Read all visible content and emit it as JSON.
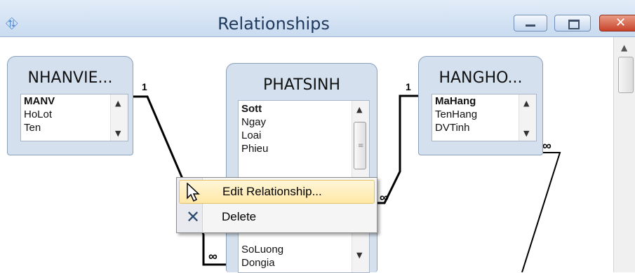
{
  "window": {
    "title": "Relationships",
    "app_icon": "relationships-icon",
    "controls": [
      "minimize-icon",
      "maximize-icon",
      "close-icon"
    ]
  },
  "tables": {
    "nhanvien": {
      "title": "NHANVIE...",
      "fields": [
        {
          "name": "MANV",
          "key": true
        },
        {
          "name": "HoLot",
          "key": false
        },
        {
          "name": "Ten",
          "key": false
        }
      ]
    },
    "phatsinh": {
      "title": "PHATSINH",
      "fields": [
        {
          "name": "Sott",
          "key": true
        },
        {
          "name": "Ngay",
          "key": false
        },
        {
          "name": "Loai",
          "key": false
        },
        {
          "name": "Phieu",
          "key": false
        },
        {
          "name": "SoLuong",
          "key": false
        },
        {
          "name": "Dongia",
          "key": false
        }
      ]
    },
    "hangho": {
      "title": "HANGHO...",
      "fields": [
        {
          "name": "MaHang",
          "key": true
        },
        {
          "name": "TenHang",
          "key": false
        },
        {
          "name": "DVTinh",
          "key": false
        }
      ]
    }
  },
  "cardinality": {
    "one": "1",
    "many": "∞"
  },
  "context_menu": {
    "items": [
      {
        "label": "Edit Relationship...",
        "icon": "cursor-icon",
        "highlighted": true
      },
      {
        "label": "Delete",
        "icon": "delete-icon",
        "highlighted": false
      }
    ]
  }
}
